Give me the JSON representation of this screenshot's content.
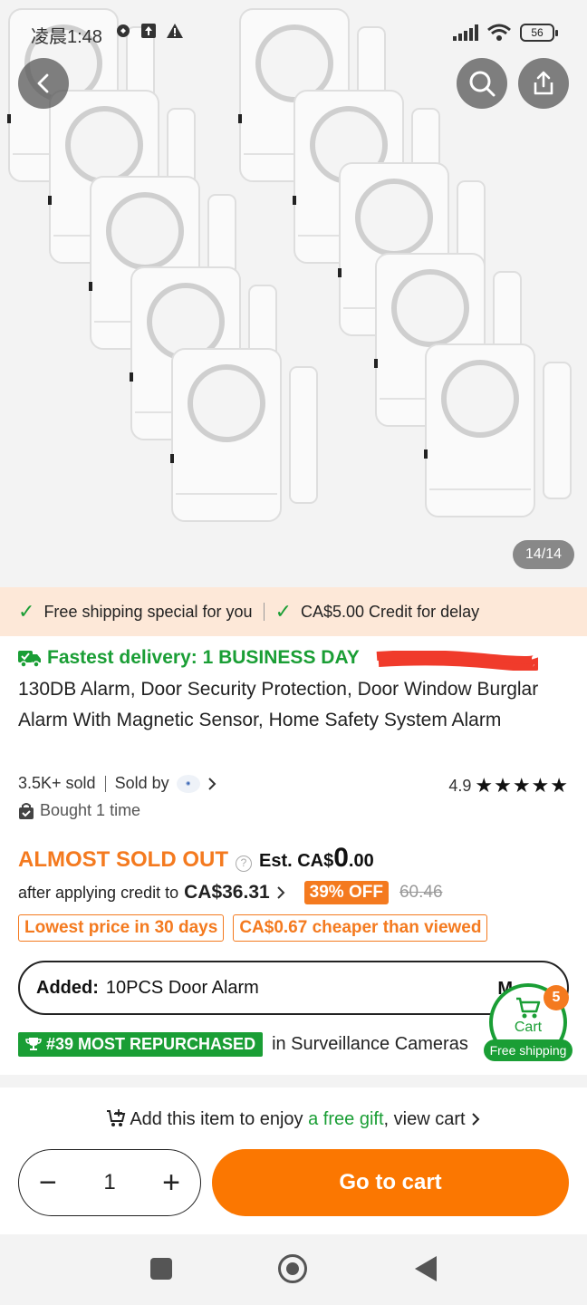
{
  "status_bar": {
    "time": "凌晨1:48",
    "battery": "56"
  },
  "gallery": {
    "counter": "14/14"
  },
  "promo": {
    "item1": "Free shipping special for you",
    "item2": "CA$5.00 Credit for delay"
  },
  "delivery": {
    "text": "Fastest delivery: 1 BUSINESS DAY"
  },
  "product": {
    "title": "130DB Alarm, Door Security Protection, Door Window Burglar Alarm With Magnetic Sensor, Home Safety System Alarm",
    "sold": "3.5K+ sold",
    "sold_by": "Sold by",
    "rating": "4.9",
    "stars": "★★★★★",
    "bought": "Bought 1 time"
  },
  "pricing": {
    "almost_sold_out": "ALMOST SOLD OUT",
    "est_prefix": "Est. CA$",
    "est_big": "0",
    "est_cents": ".00",
    "after_credit_label": "after applying credit to",
    "credit_price": "CA$36.31",
    "discount": "39% OFF",
    "old_price": "60.46",
    "tag_lowest": "Lowest price in 30 days",
    "tag_cheaper": "CA$0.67 cheaper than viewed"
  },
  "variant": {
    "added_label": "Added:",
    "value": "10PCS Door Alarm",
    "more": "M"
  },
  "cart": {
    "label": "Cart",
    "count": "5",
    "shipping": "Free shipping"
  },
  "ranking": {
    "badge": "#39 MOST REPURCHASED",
    "category": "in Surveillance Cameras"
  },
  "footer": {
    "gift_prefix": "Add this item to enjoy ",
    "gift_link": "a free gift",
    "gift_suffix": ", view cart",
    "quantity": "1",
    "go_to_cart": "Go to cart"
  },
  "colors": {
    "accent_orange": "#fb7701",
    "green": "#1a9e35",
    "promo_bg": "#fde8d8"
  }
}
